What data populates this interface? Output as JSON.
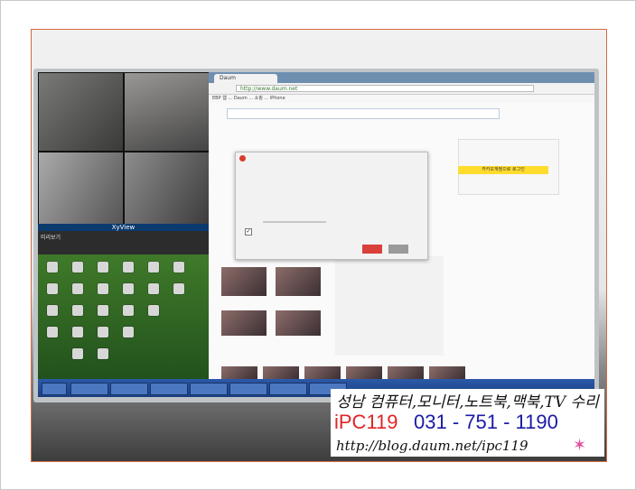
{
  "overlay": {
    "line1": "성남 컴퓨터,모니터,노트북,맥북,TV 수리",
    "brand": "iPC119",
    "phone": "031 - 751 - 1190",
    "url": "http://blog.daum.net/ipc119"
  },
  "screen": {
    "cctv_title": "XyView",
    "cctv_menu": "미리보기",
    "browser_tab": "Daum",
    "browser_url": "http://www.daum.net",
    "bookmarks": "EBP  웹  ...  Daum  ...  쇼핑  ...  iPhone",
    "login_button": "카카오계정으로 로그인",
    "dialog_check": "✓"
  },
  "colors": {
    "accent_red": "#e02525",
    "accent_blue": "#1a1aa8",
    "frame_border": "#d46a43"
  }
}
